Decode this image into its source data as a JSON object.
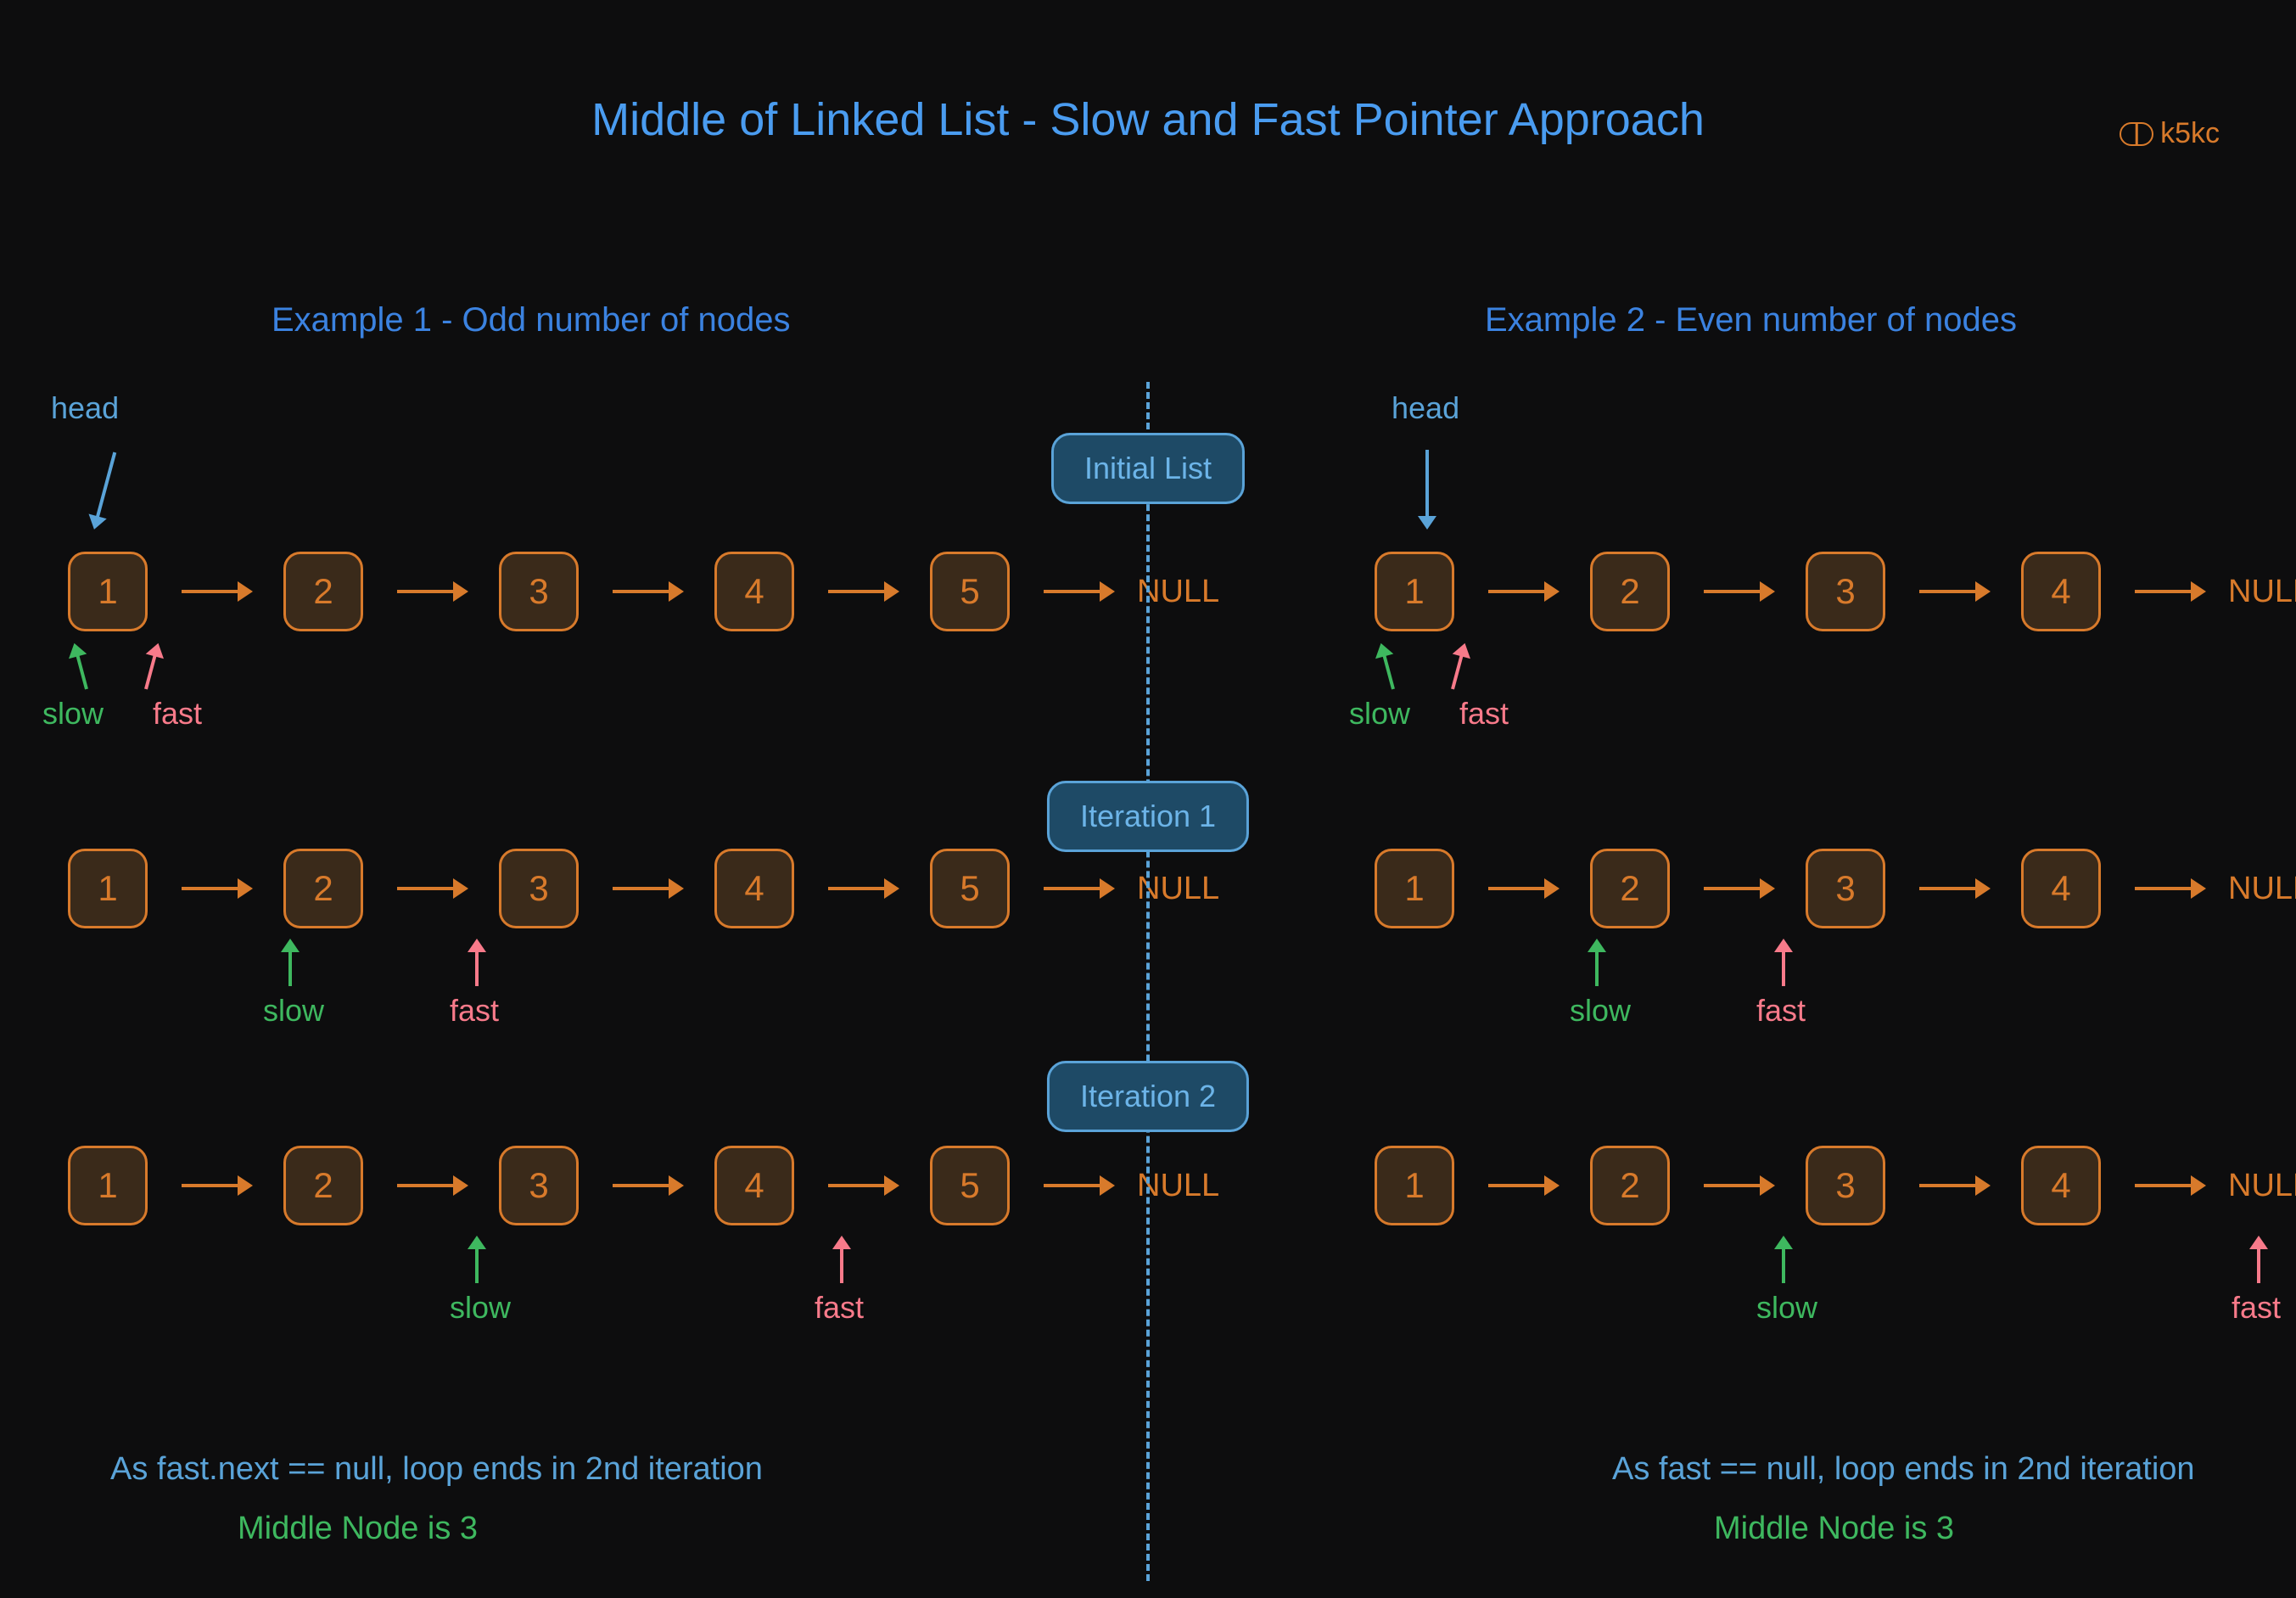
{
  "watermark": "k5kc",
  "title": "Middle of Linked List - Slow and Fast Pointer Approach",
  "example1_label": "Example 1 - Odd number of nodes",
  "example2_label": "Example 2 - Even number of nodes",
  "stages": {
    "initial": "Initial List",
    "iter1": "Iteration 1",
    "iter2": "Iteration 2"
  },
  "null_label": "NULL",
  "head_label": "head",
  "slow_label": "slow",
  "fast_label": "fast",
  "ex1": {
    "nodes": [
      "1",
      "2",
      "3",
      "4",
      "5"
    ],
    "initial": {
      "slow_idx": 0,
      "fast_idx": 0
    },
    "iter1": {
      "slow_idx": 1,
      "fast_idx": 2
    },
    "iter2": {
      "slow_idx": 2,
      "fast_idx": 4
    }
  },
  "ex2": {
    "nodes": [
      "1",
      "2",
      "3",
      "4"
    ],
    "initial": {
      "slow_idx": 0,
      "fast_idx": 0
    },
    "iter1": {
      "slow_idx": 1,
      "fast_idx": 2
    },
    "iter2": {
      "slow_idx": 2,
      "fast_idx": "null"
    }
  },
  "ex1_footer_cond": "As fast.next == null, loop ends in 2nd iteration",
  "ex1_footer_res": "Middle Node is 3",
  "ex2_footer_cond": "As fast == null, loop ends in 2nd iteration",
  "ex2_footer_res": "Middle Node is 3",
  "colors": {
    "blue": "#5aa3d8",
    "green": "#3eb85f",
    "pink": "#f87a8a",
    "orange": "#d87a2b"
  }
}
